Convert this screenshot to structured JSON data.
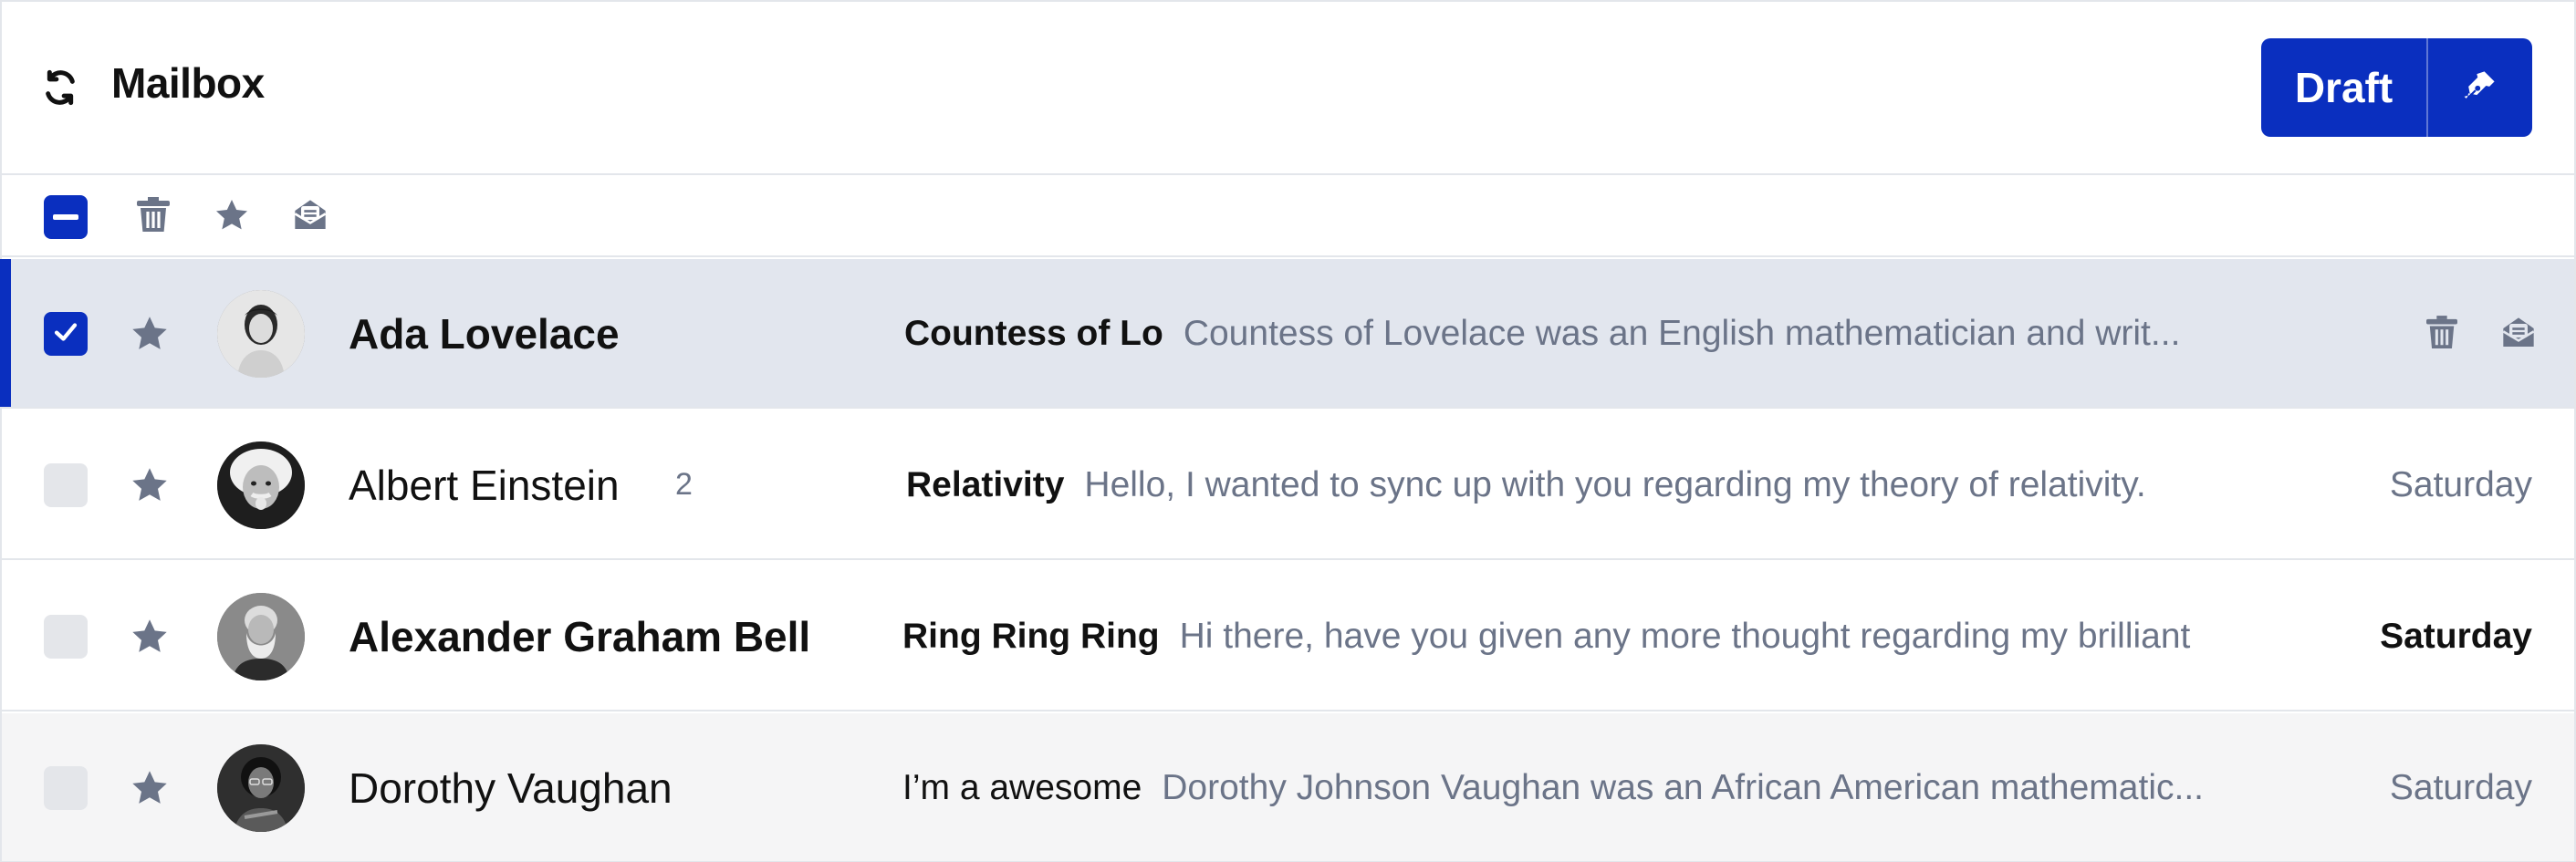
{
  "header": {
    "title": "Mailbox",
    "draft_label": "Draft",
    "refresh_icon": "refresh-icon",
    "compose_icon": "pen-icon"
  },
  "toolbar": {
    "icons": [
      "select-all-indeterminate-icon",
      "trash-icon",
      "star-icon",
      "mark-read-icon"
    ]
  },
  "colors": {
    "accent": "#0a2fbf",
    "muted": "#6b7488",
    "selected_row": "#e2e6ee",
    "border": "#e3e6eb"
  },
  "messages": [
    {
      "sender": "Ada Lovelace",
      "count": "",
      "subject": "Countess of Lo",
      "preview": "Countess of Lovelace was an English mathematician and writ...",
      "date": "",
      "checked": true,
      "unread": true,
      "hover_actions": [
        "trash-icon",
        "mark-read-icon"
      ]
    },
    {
      "sender": "Albert Einstein",
      "count": "2",
      "subject": "Relativity",
      "preview": "Hello, I wanted to sync up with you regarding my theory of relativity.",
      "date": "Saturday",
      "checked": false,
      "unread": true
    },
    {
      "sender": "Alexander Graham Bell",
      "count": "",
      "subject": "Ring Ring Ring",
      "preview": "Hi there, have you given any more thought regarding my brilliant",
      "date": "Saturday",
      "checked": false,
      "unread": true
    },
    {
      "sender": "Dorothy Vaughan",
      "count": "",
      "subject": "I’m a awesome",
      "preview": "Dorothy Johnson Vaughan was an African American mathematic...",
      "date": "Saturday",
      "checked": false,
      "unread": false
    }
  ]
}
